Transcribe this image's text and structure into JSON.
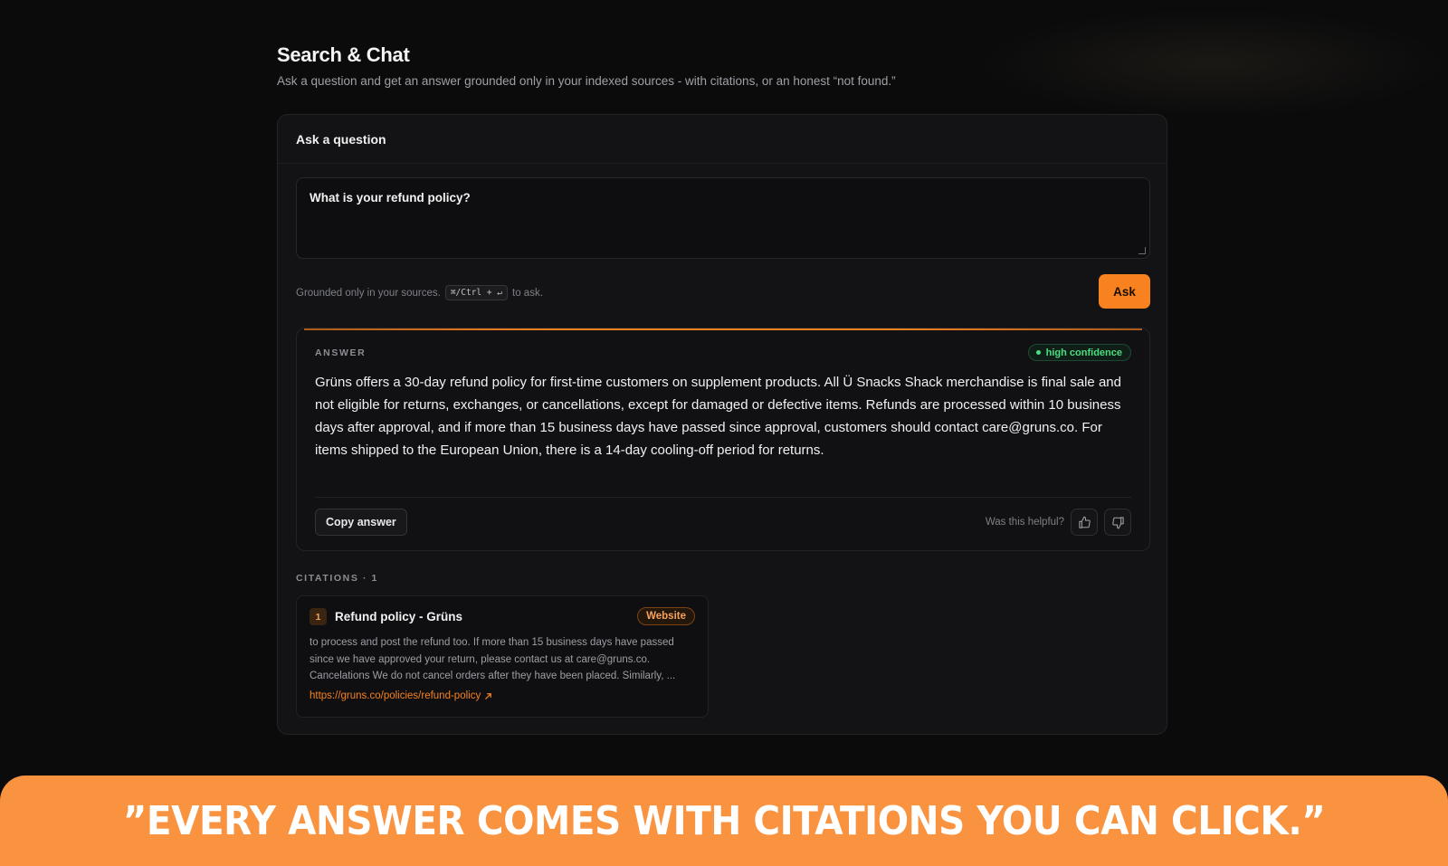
{
  "page": {
    "title": "Search & Chat",
    "subtitle": "Ask a question and get an answer grounded only in your indexed sources - with citations, or an honest “not found.”"
  },
  "ask": {
    "card_title": "Ask a question",
    "question_value": "What is your refund policy?",
    "hint_prefix": "Grounded only in your sources.",
    "hint_kbd": "⌘/Ctrl + ↵",
    "hint_suffix": "to ask.",
    "ask_label": "Ask"
  },
  "answer": {
    "label": "ANSWER",
    "confidence": "high confidence",
    "text": "Grüns offers a 30-day refund policy for first-time customers on supplement products. All Ü Snacks Shack merchandise is final sale and not eligible for returns, exchanges, or cancellations, except for damaged or defective items. Refunds are processed within 10 business days after approval, and if more than 15 business days have passed since approval, customers should contact care@gruns.co. For items shipped to the European Union, there is a 14-day cooling-off period for returns.",
    "copy_label": "Copy answer",
    "helpful_label": "Was this helpful?"
  },
  "citations": {
    "label": "CITATIONS · 1",
    "items": [
      {
        "number": "1",
        "title": "Refund policy - Grüns",
        "badge": "Website",
        "snippet": "to process and post the refund too. If more than 15 business days have passed since we have approved your return, please contact us at care@gruns.co. Cancelations We do not cancel orders after they have been placed. Similarly, ...",
        "url": "https://gruns.co/policies/refund-policy"
      }
    ]
  },
  "banner": {
    "text": "”EVERY ANSWER COMES WITH CITATIONS YOU CAN CLICK.”"
  },
  "colors": {
    "accent": "#f7821f",
    "banner": "#fa9340",
    "confidence": "#4ade80",
    "background": "#0b0b0c"
  },
  "icons": {
    "thumbs_up": "thumbs-up-icon",
    "thumbs_down": "thumbs-down-icon",
    "external_link": "external-link-icon"
  }
}
